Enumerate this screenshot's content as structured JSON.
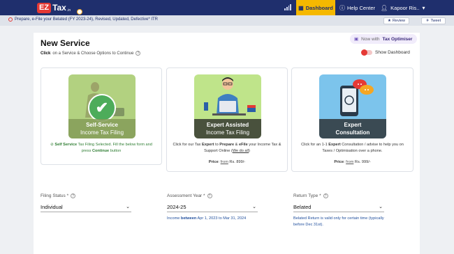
{
  "header": {
    "logo_ez": "EZ",
    "logo_tax": "Tax",
    "logo_suffix": ".in",
    "nav": [
      {
        "label": "Dashboard",
        "icon": "dashboard-icon",
        "active": true
      },
      {
        "label": "Help Center",
        "icon": "info-icon"
      },
      {
        "label": "Kapoor Ris..",
        "icon": "user-icon"
      }
    ]
  },
  "announcement": {
    "text": "Prepare, e-File your Belated (FY 2023-24), Revised, Updated, Defective* ITR",
    "review_label": "Review",
    "tweet_label": "Tweet"
  },
  "page": {
    "title": "New Service",
    "subtitle_bold": "Click",
    "subtitle_rest": "on a Service & Choose Options to Continue",
    "optimiser_now": "Now with",
    "optimiser_label": "Tax Optimiser",
    "show_dashboard": "Show Dashboard",
    "show_dashboard_on": false
  },
  "cards": [
    {
      "band_line1": "Self-Service",
      "band_line2": "Income Tax Filing",
      "selected": true,
      "desc_bold": "Self Service",
      "desc_rest": "Tax Filing Selected. Fill the below form and press",
      "desc_bold2": "Continue",
      "desc_end": "button"
    },
    {
      "band_line1": "Expert Assisted",
      "band_line2": "Income Tax Filing",
      "desc_a": "Click for our Tax",
      "desc_b": "Expert",
      "desc_c": "to",
      "desc_d": "Prepare",
      "desc_e": "&",
      "desc_f": "eFile",
      "desc_g": "your Income Tax & Support Online (",
      "desc_h": "We do all",
      "desc_i": ")",
      "price_label": "Price",
      "price_from": "from",
      "price_value": "Rs. 899/-"
    },
    {
      "band_line1": "Expert",
      "band_line2": "Consultation",
      "desc_a": "Click for an 1-1",
      "desc_b": "Expert",
      "desc_c": "Consultation / advise to help you on Taxes / Optimisation over a phone.",
      "price_label": "Price",
      "price_from": "from",
      "price_value": "Rs. 999/-"
    }
  ],
  "form": {
    "filing_status": {
      "label": "Filing Status *",
      "value": "Individual"
    },
    "assessment_year": {
      "label": "Assessment Year *",
      "value": "2024-25",
      "hint_a": "Income",
      "hint_b": "between",
      "hint_c": "Apr 1, 2023 to Mar 31, 2024"
    },
    "return_type": {
      "label": "Return Type *",
      "value": "Belated",
      "hint": "Belated Return is valid only for certain time (typically before Dec 31st)."
    }
  }
}
